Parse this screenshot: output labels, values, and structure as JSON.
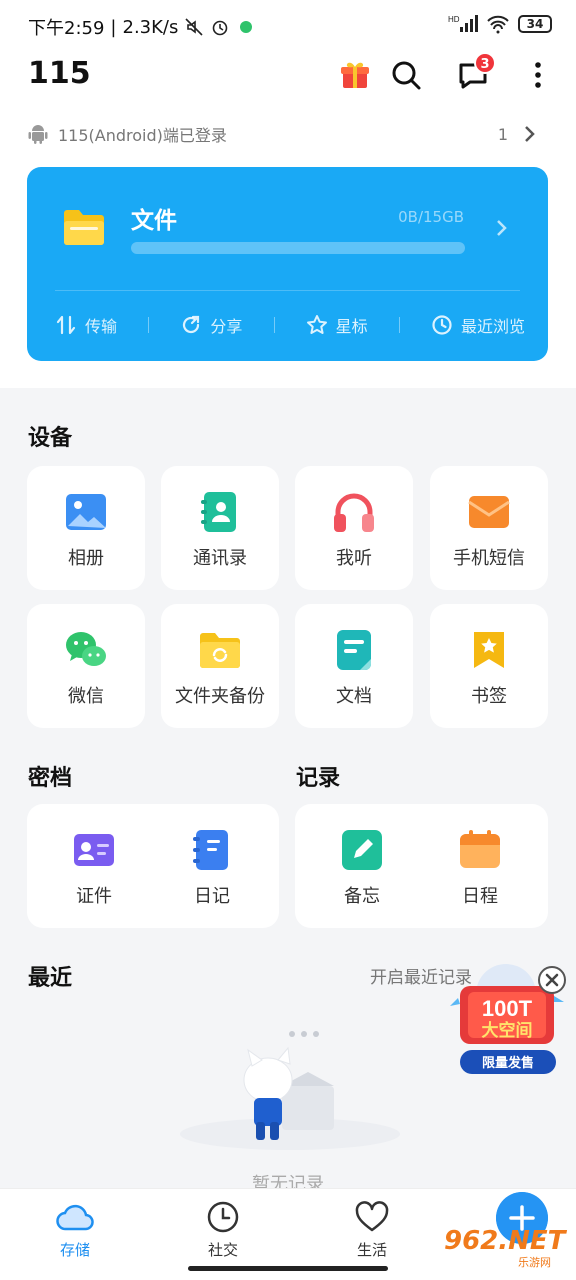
{
  "status_bar": {
    "time": "下午2:59",
    "net_speed": "2.3K/s",
    "network_label": "HD",
    "battery": "34"
  },
  "header": {
    "title": "115",
    "message_badge": "3"
  },
  "login_notice": {
    "text": "115(Android)端已登录",
    "count": "1"
  },
  "files_card": {
    "title": "文件",
    "quota": "0B/15GB",
    "used_fraction": 0,
    "actions": [
      {
        "label": "传输",
        "icon": "transfer-icon"
      },
      {
        "label": "分享",
        "icon": "share-icon"
      },
      {
        "label": "星标",
        "icon": "star-icon"
      },
      {
        "label": "最近浏览",
        "icon": "history-icon"
      }
    ]
  },
  "devices": {
    "title": "设备",
    "items": [
      {
        "label": "相册",
        "icon": "album-icon",
        "color": "#3b8ff3"
      },
      {
        "label": "通讯录",
        "icon": "contacts-icon",
        "color": "#1fbf9a"
      },
      {
        "label": "我听",
        "icon": "headphones-icon",
        "color": "#f0525d"
      },
      {
        "label": "手机短信",
        "icon": "sms-icon",
        "color": "#f7892c"
      },
      {
        "label": "微信",
        "icon": "wechat-icon",
        "color": "#2fc36b"
      },
      {
        "label": "文件夹备份",
        "icon": "folder-backup-icon",
        "color": "#f8c21c"
      },
      {
        "label": "文档",
        "icon": "document-icon",
        "color": "#1fb7b8"
      },
      {
        "label": "书签",
        "icon": "bookmark-icon",
        "color": "#f5b811"
      }
    ]
  },
  "vault": {
    "title": "密档",
    "items": [
      {
        "label": "证件",
        "icon": "id-card-icon",
        "color": "#7a5cf0"
      },
      {
        "label": "日记",
        "icon": "diary-icon",
        "color": "#3b7ff0"
      }
    ]
  },
  "records": {
    "title": "记录",
    "items": [
      {
        "label": "备忘",
        "icon": "memo-icon",
        "color": "#1fbf9a"
      },
      {
        "label": "日程",
        "icon": "calendar-icon",
        "color": "#f7892c"
      }
    ]
  },
  "recent": {
    "title": "最近",
    "toggle_label": "开启最近记录",
    "empty_text": "暂无记录"
  },
  "promo": {
    "headline": "100T",
    "subline": "大空间",
    "button": "限量发售"
  },
  "bottom_nav": [
    {
      "label": "存储",
      "icon": "cloud-icon",
      "active": true
    },
    {
      "label": "社交",
      "icon": "clock-icon",
      "active": false
    },
    {
      "label": "生活",
      "icon": "heart-icon",
      "active": false
    }
  ],
  "watermark": {
    "brand": "962.NET",
    "sub": "乐游网"
  }
}
